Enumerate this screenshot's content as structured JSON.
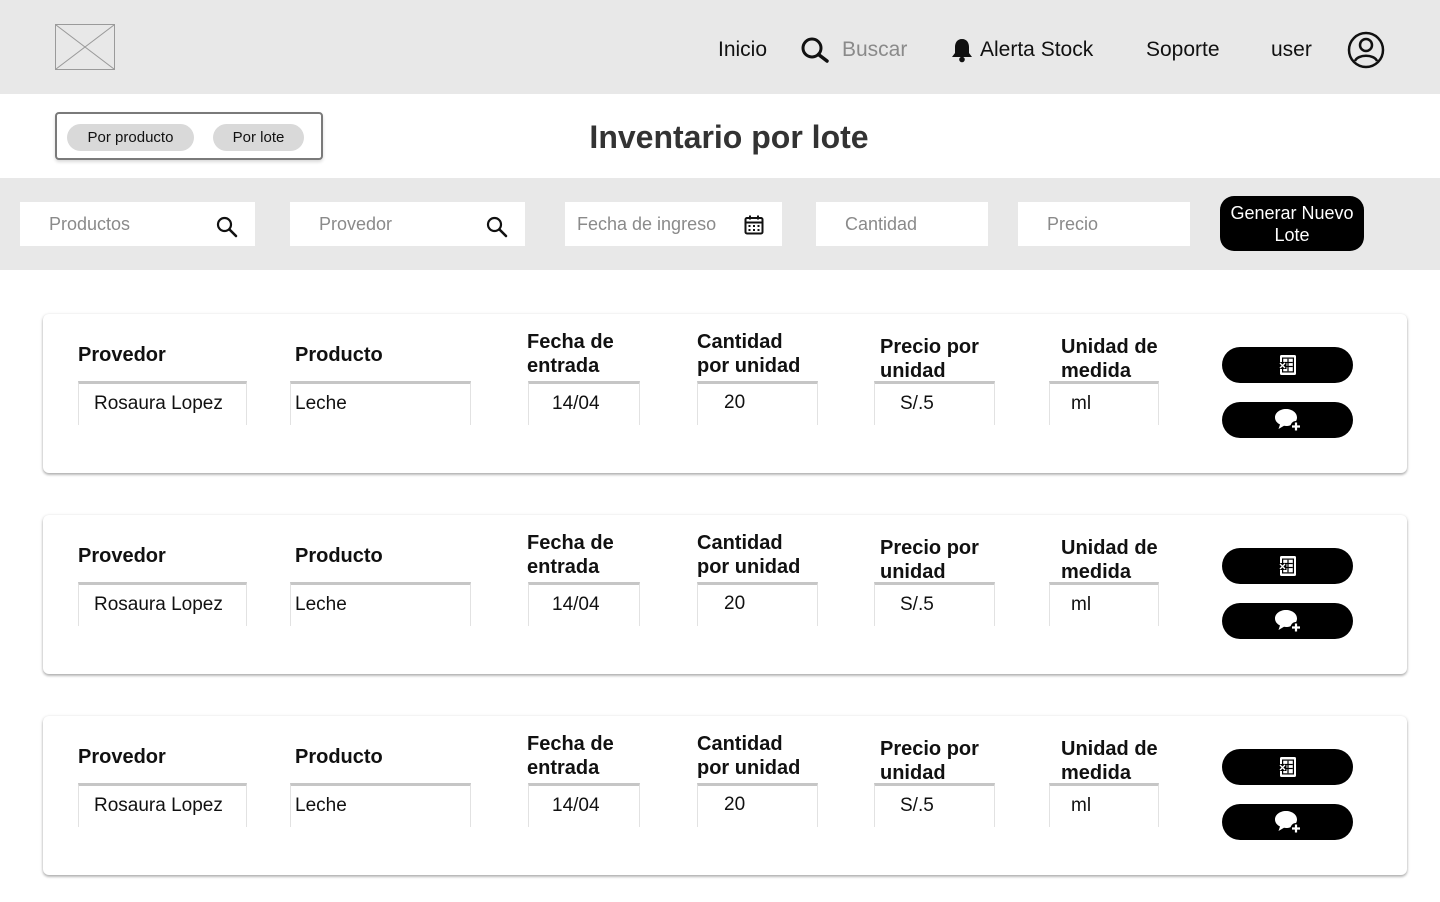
{
  "header": {
    "nav": {
      "inicio": "Inicio",
      "buscar": "Buscar",
      "alerta": "Alerta Stock",
      "soporte": "Soporte",
      "user": "user"
    }
  },
  "toggle": {
    "por_producto": "Por producto",
    "por_lote": "Por lote"
  },
  "page_title": "Inventario por lote",
  "filters": {
    "productos_placeholder": "Productos",
    "provedor_placeholder": "Provedor",
    "fecha_placeholder": "Fecha de ingreso",
    "cantidad_placeholder": "Cantidad",
    "precio_placeholder": "Precio",
    "generate_button": "Generar Nuevo Lote"
  },
  "labels": {
    "provedor": "Provedor",
    "producto": "Producto",
    "fecha_1": "Fecha de",
    "fecha_2": "entrada",
    "cantidad_1": "Cantidad",
    "cantidad_2": "por unidad",
    "precio_1": "Precio por",
    "precio_2": "unidad",
    "unidad_1": "Unidad de",
    "unidad_2": "medida"
  },
  "lotes": [
    {
      "provedor": "Rosaura Lopez",
      "producto": "Leche",
      "fecha": "14/04",
      "cantidad": "20",
      "precio": "S/.5",
      "unidad": "ml"
    },
    {
      "provedor": "Rosaura Lopez",
      "producto": "Leche",
      "fecha": "14/04",
      "cantidad": "20",
      "precio": "S/.5",
      "unidad": "ml"
    },
    {
      "provedor": "Rosaura Lopez",
      "producto": "Leche",
      "fecha": "14/04",
      "cantidad": "20",
      "precio": "S/.5",
      "unidad": "ml"
    }
  ]
}
